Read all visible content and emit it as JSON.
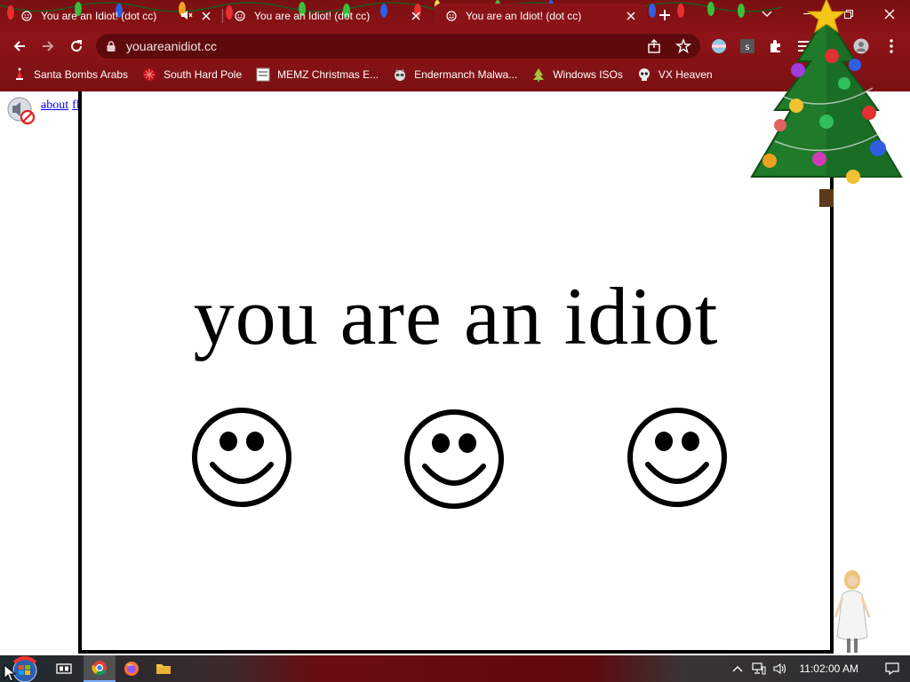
{
  "browser": {
    "tabs": [
      {
        "title": "You are an Idiot! (dot cc)",
        "muted": false,
        "active": false
      },
      {
        "title": "You are an Idiot! (dot cc)",
        "muted": true,
        "active": false
      },
      {
        "title": "You are an Idiot! (dot cc)",
        "muted": false,
        "active": true
      }
    ],
    "url": "youareanidiot.cc",
    "theme_color": "#8a1317",
    "bookmarks": [
      {
        "label": "Santa Bombs Arabs",
        "icon": "santa-icon"
      },
      {
        "label": "South Hard Pole",
        "icon": "snowflake-icon"
      },
      {
        "label": "MEMZ Christmas E...",
        "icon": "page-icon"
      },
      {
        "label": "Endermanch Malwa...",
        "icon": "raccoon-icon"
      },
      {
        "label": "Windows ISOs",
        "icon": "tree-icon"
      },
      {
        "label": "VX Heaven",
        "icon": "skull-icon"
      }
    ]
  },
  "page": {
    "links": [
      "about",
      "flash"
    ],
    "headline": "you are an idiot",
    "smiley_count": 3
  },
  "taskbar": {
    "clock": "11:02:00 AM"
  }
}
